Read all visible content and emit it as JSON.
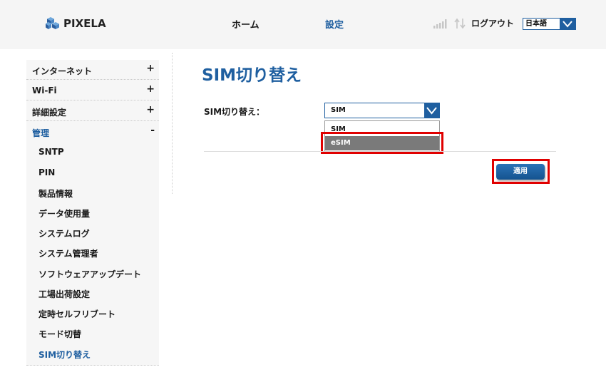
{
  "header": {
    "logo_text": "PIXELA",
    "logo_icon": "cube-cluster-logo",
    "nav": {
      "home": "ホーム",
      "settings": "設定"
    },
    "signal_icon": "signal-bars-icon",
    "transfer_icon": "up-down-arrows-icon",
    "logout": "ログアウト",
    "language": "日本語"
  },
  "sidebar": {
    "sections": [
      {
        "label": "インターネット",
        "toggle": "+"
      },
      {
        "label": "Wi-Fi",
        "toggle": "+"
      },
      {
        "label": "詳細設定",
        "toggle": "+"
      },
      {
        "label": "管理",
        "toggle": "-"
      }
    ],
    "sub_items": [
      "SNTP",
      "PIN",
      "製品情報",
      "データ使用量",
      "システムログ",
      "システム管理者",
      "ソフトウェアアップデート",
      "工場出荷設定",
      "定時セルフリブート",
      "モード切替",
      "SIM切り替え"
    ]
  },
  "main": {
    "title": "SIM切り替え",
    "field_label": "SIM切り替え：",
    "select_value": "SIM",
    "options": [
      "SIM",
      "eSIM"
    ],
    "highlighted_option": "eSIM",
    "apply_label": "適用"
  },
  "colors": {
    "accent": "#1f5fa0",
    "highlight": "#e00000",
    "option_hover": "#7a7a7a",
    "header_bg": "#f5f5f5",
    "sidebar_bg": "#f6f6f6"
  }
}
